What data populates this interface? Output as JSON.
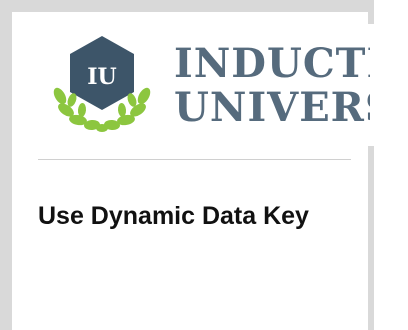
{
  "brand": {
    "badge_text": "IU",
    "wordmark_line1": "INDUCTIVE",
    "wordmark_line2": "UNIVERSITY",
    "badge_color": "#3d5569",
    "laurel_color": "#8cc63f",
    "wordmark_color": "#566b7d"
  },
  "page": {
    "title": "Use Dynamic Data Key"
  }
}
